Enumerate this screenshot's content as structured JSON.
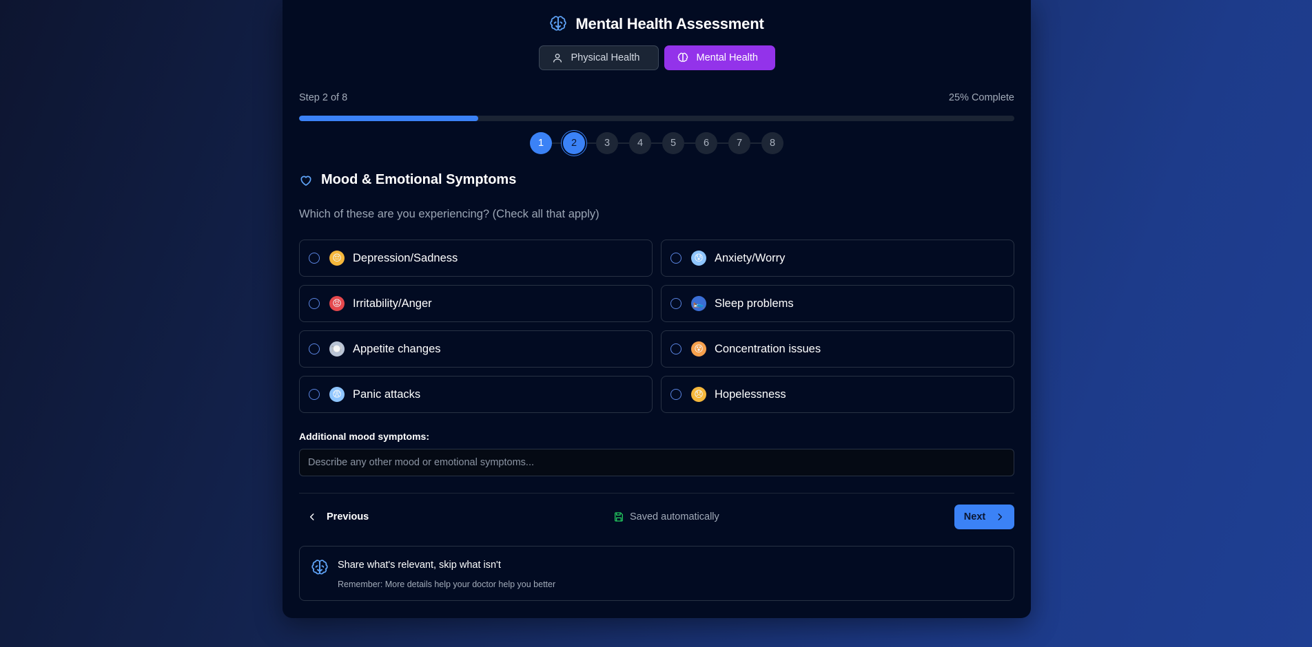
{
  "header": {
    "title": "Mental Health Assessment",
    "icon": "brain-icon"
  },
  "mode_toggle": {
    "physical_label": "Physical Health",
    "mental_label": "Mental Health",
    "active": "mental"
  },
  "progress": {
    "step_text": "Step 2 of 8",
    "complete_text": "25% Complete",
    "percent": 25,
    "current_step": 2,
    "steps": [
      "1",
      "2",
      "3",
      "4",
      "5",
      "6",
      "7",
      "8"
    ]
  },
  "section": {
    "title": "Mood & Emotional Symptoms",
    "icon": "heart-icon",
    "question": "Which of these are you experiencing? (Check all that apply)"
  },
  "options": [
    {
      "label": "Depression/Sadness",
      "emoji": "😔",
      "checked": false
    },
    {
      "label": "Anxiety/Worry",
      "emoji": "😰",
      "checked": false
    },
    {
      "label": "Irritability/Anger",
      "emoji": "😡",
      "checked": false
    },
    {
      "label": "Sleep problems",
      "emoji": "🛌",
      "checked": false
    },
    {
      "label": "Appetite changes",
      "emoji": "🍽️",
      "checked": false
    },
    {
      "label": "Concentration issues",
      "emoji": "😵",
      "checked": false
    },
    {
      "label": "Panic attacks",
      "emoji": "😨",
      "checked": false
    },
    {
      "label": "Hopelessness",
      "emoji": "😞",
      "checked": false
    }
  ],
  "additional": {
    "label": "Additional mood symptoms:",
    "placeholder": "Describe any other mood or emotional symptoms...",
    "value": ""
  },
  "nav": {
    "previous_label": "Previous",
    "saved_text": "Saved automatically",
    "next_label": "Next"
  },
  "tip": {
    "title": "Share what's relevant, skip what isn't",
    "subtitle": "Remember: More details help your doctor help you better"
  },
  "colors": {
    "accent": "#3b82f6",
    "mental_active": "#9333ea",
    "saved_icon": "#22c55e",
    "card_bg": "#020b22"
  }
}
